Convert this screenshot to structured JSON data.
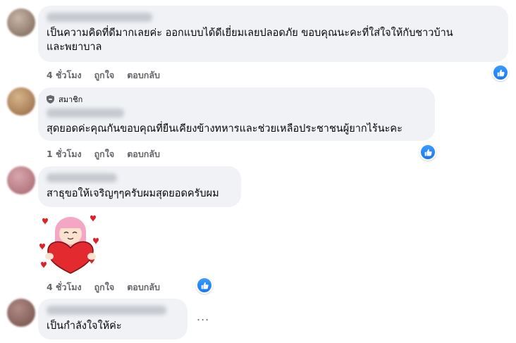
{
  "comments": [
    {
      "text": "เป็นความคิดที่ดีมากเลยค่ะ ออกแบบได้ดีเยี่ยมเลยปลอดภัย ขอบคุณนะคะที่ใส่ใจให้กับชาวบ้าน\nและพยาบาล",
      "time": "4 ชั่วโมง",
      "like": "ถูกใจ",
      "reply": "ตอบกลับ"
    },
    {
      "badge": "สมาชิก",
      "text": "สุดยอดค่ะคุณกันขอบคุณที่ยืนเคียงข้างทหารและช่วยเหลือประชาชนผู้ยากไร้นะคะ",
      "time": "1 ชั่วโมง",
      "like": "ถูกใจ",
      "reply": "ตอบกลับ"
    },
    {
      "text": "สาธุขอให้เจริญๆๆครับผมสุดยอดครับผม",
      "sticker": "heart-sticker",
      "time": "4 ชั่วโมง",
      "like": "ถูกใจ",
      "reply": "ตอบกลับ"
    },
    {
      "text": "เป็นกำลังใจให้ค่ะ",
      "more": "..."
    }
  ],
  "icons": {
    "like": "thumbs-up-icon",
    "badge": "shield-icon"
  },
  "colors": {
    "like_blue": "#1877f2",
    "bubble": "#f0f2f5",
    "meta": "#65676b"
  }
}
